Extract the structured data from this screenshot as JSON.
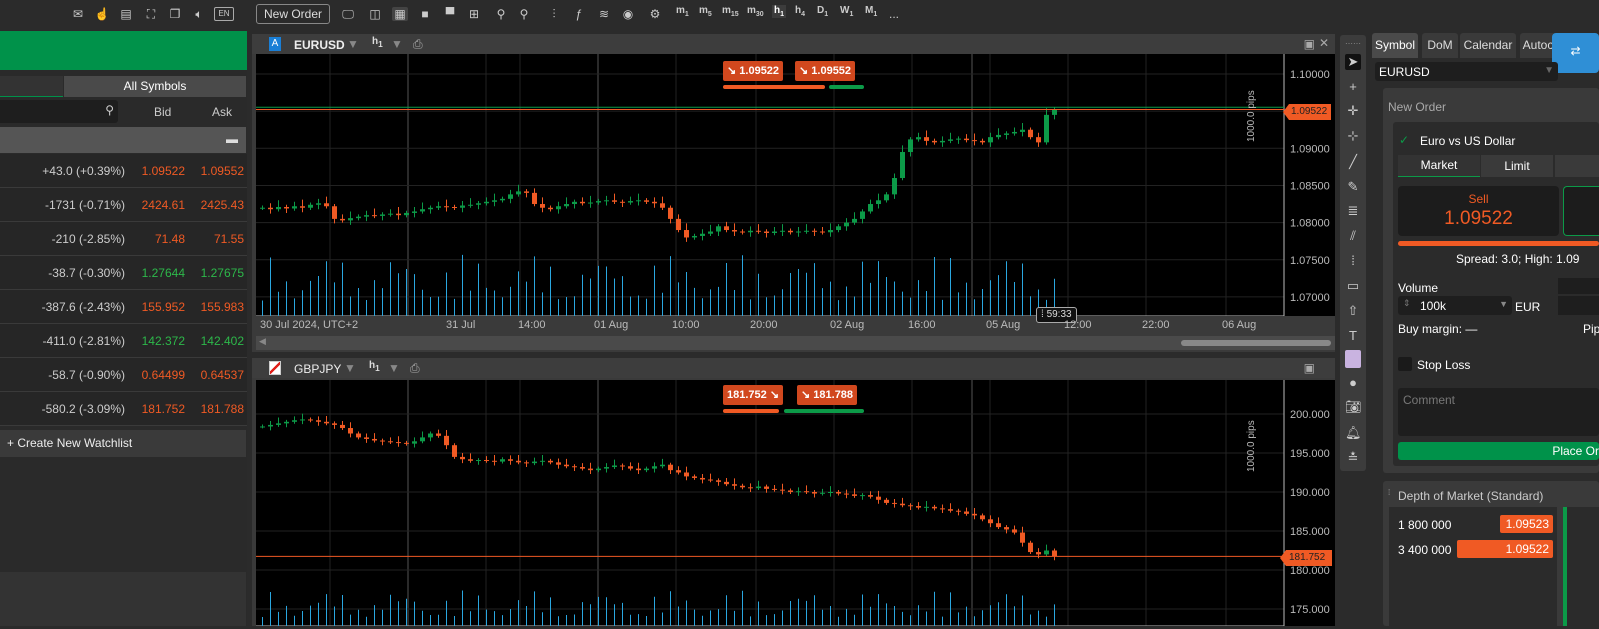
{
  "topbar": {
    "lang": "EN",
    "new_order": "New Order",
    "timeframes": [
      {
        "t": "m",
        "n": "1"
      },
      {
        "t": "m",
        "n": "5"
      },
      {
        "t": "m",
        "n": "15"
      },
      {
        "t": "m",
        "n": "30"
      },
      {
        "t": "h",
        "n": "1"
      },
      {
        "t": "h",
        "n": "4"
      },
      {
        "t": "D",
        "n": "1"
      },
      {
        "t": "W",
        "n": "1"
      },
      {
        "t": "M",
        "n": "1"
      }
    ],
    "more": "..."
  },
  "watchlist": {
    "tab_all": "All Symbols",
    "col_bid": "Bid",
    "col_ask": "Ask",
    "create": "+ Create New Watchlist",
    "rows": [
      {
        "change": "+43.0 (+0.39%)",
        "bid": "1.09522",
        "ask": "1.09552",
        "dir": "red"
      },
      {
        "change": "-1731 (-0.71%)",
        "bid": "2424.61",
        "ask": "2425.43",
        "dir": "red"
      },
      {
        "change": "-210 (-2.85%)",
        "bid": "71.48",
        "ask": "71.55",
        "dir": "red"
      },
      {
        "change": "-38.7 (-0.30%)",
        "bid": "1.27644",
        "ask": "1.27675",
        "dir": "grn"
      },
      {
        "change": "-387.6 (-2.43%)",
        "bid": "155.952",
        "ask": "155.983",
        "dir": "red"
      },
      {
        "change": "-411.0 (-2.81%)",
        "bid": "142.372",
        "ask": "142.402",
        "dir": "grn"
      },
      {
        "change": "-58.7 (-0.90%)",
        "bid": "0.64499",
        "ask": "0.64537",
        "dir": "red"
      },
      {
        "change": "-580.2 (-3.09%)",
        "bid": "181.752",
        "ask": "181.788",
        "dir": "red"
      }
    ]
  },
  "chart1": {
    "symbol": "EURUSD",
    "tf": "h",
    "tf_n": "1",
    "badge": "A",
    "sell": "1.09522",
    "buy": "1.09552",
    "price_tag": "1.09522",
    "pips": "1000.0 pips",
    "countdown": "59:33",
    "yticks": [
      "1.10000",
      "1.09500",
      "1.09000",
      "1.08500",
      "1.08000",
      "1.07500",
      "1.07000"
    ],
    "xticks": [
      "30 Jul 2024, UTC+2",
      "31 Jul",
      "14:00",
      "01 Aug",
      "10:00",
      "20:00",
      "02 Aug",
      "16:00",
      "05 Aug",
      "12:00",
      "22:00",
      "06 Aug"
    ]
  },
  "chart2": {
    "symbol": "GBPJPY",
    "tf": "h",
    "tf_n": "1",
    "sell": "181.752",
    "buy": "181.788",
    "price_tag": "181.752",
    "pips": "1000.0 pips",
    "yticks": [
      "200.000",
      "195.000",
      "190.000",
      "185.000",
      "180.000",
      "175.000"
    ]
  },
  "chart_data": [
    {
      "type": "candlestick",
      "symbol": "EURUSD",
      "ylim": [
        1.0675,
        1.1035
      ],
      "close": [
        1.082,
        1.0818,
        1.0821,
        1.0819,
        1.0822,
        1.082,
        1.0824,
        1.0826,
        1.0822,
        1.0805,
        1.0803,
        1.0806,
        1.0808,
        1.081,
        1.0809,
        1.0811,
        1.0812,
        1.081,
        1.0813,
        1.0815,
        1.0818,
        1.082,
        1.0822,
        1.0821,
        1.082,
        1.0823,
        1.0824,
        1.0826,
        1.0828,
        1.083,
        1.0832,
        1.0838,
        1.0842,
        1.084,
        1.0825,
        1.082,
        1.0818,
        1.0822,
        1.0825,
        1.0828,
        1.0826,
        1.0827,
        1.0829,
        1.083,
        1.0828,
        1.0827,
        1.0829,
        1.083,
        1.0828,
        1.0826,
        1.082,
        1.0805,
        1.079,
        1.078,
        1.0782,
        1.0785,
        1.0788,
        1.0795,
        1.079,
        1.0788,
        1.0787,
        1.0789,
        1.0788,
        1.0786,
        1.0788,
        1.0789,
        1.0787,
        1.0788,
        1.0789,
        1.0788,
        1.0787,
        1.079,
        1.0795,
        1.08,
        1.0805,
        1.0815,
        1.0825,
        1.083,
        1.0838,
        1.086,
        1.0895,
        1.0912,
        1.0915,
        1.091,
        1.0908,
        1.091,
        1.0912,
        1.0913,
        1.0911,
        1.091,
        1.0908,
        1.0915,
        1.0918,
        1.092,
        1.0922,
        1.0925,
        1.0915,
        1.0908,
        1.0945,
        1.0952
      ]
    },
    {
      "type": "candlestick",
      "symbol": "GBPJPY",
      "ylim": [
        174,
        205
      ],
      "close": [
        198.4,
        198.6,
        198.8,
        199.0,
        199.2,
        199.3,
        199.2,
        199.0,
        198.8,
        198.6,
        198.2,
        197.5,
        197.0,
        196.8,
        196.6,
        196.5,
        196.4,
        196.3,
        196.2,
        196.5,
        197.0,
        197.5,
        197.2,
        196.0,
        194.5,
        194.2,
        194.0,
        194.1,
        194.0,
        193.9,
        194.2,
        194.0,
        193.8,
        193.7,
        193.9,
        194.0,
        193.8,
        193.5,
        193.3,
        193.2,
        193.0,
        192.8,
        193.0,
        193.2,
        193.4,
        193.3,
        193.0,
        192.8,
        193.0,
        193.3,
        193.5,
        192.8,
        192.5,
        192.0,
        191.8,
        191.6,
        191.5,
        191.3,
        191.0,
        190.8,
        190.6,
        190.5,
        190.7,
        190.4,
        190.3,
        190.2,
        190.0,
        190.1,
        190.0,
        189.8,
        189.9,
        190.0,
        189.8,
        189.7,
        189.5,
        189.6,
        189.4,
        189.0,
        188.6,
        188.5,
        188.3,
        188.2,
        188.0,
        188.1,
        187.9,
        187.8,
        187.6,
        187.5,
        187.2,
        187.0,
        186.5,
        186.0,
        185.5,
        185.2,
        184.8,
        183.5,
        182.3,
        182.0,
        182.5,
        181.75
      ]
    }
  ],
  "right": {
    "tabs": [
      "Symbol",
      "DoM",
      "Calendar",
      "Autoc"
    ],
    "symbol": "EURUSD",
    "new_order": "New Order",
    "instrument": "Euro vs US Dollar",
    "order_tabs": [
      "Market",
      "Limit"
    ],
    "sell_label": "Sell",
    "sell_price": "1.09522",
    "spread": "Spread: 3.0; High: 1.09",
    "volume_label": "Volume",
    "volume": "100k",
    "currency": "EUR",
    "buy_margin": "Buy margin: —",
    "pip": "Pip",
    "stop_loss": "Stop Loss",
    "comment_placeholder": "Comment",
    "place": "Place Or",
    "dom_title": "Depth of Market (Standard)",
    "dom": [
      {
        "vol": "1 800 000",
        "price": "1.09523"
      },
      {
        "vol": "3 400 000",
        "price": "1.09522"
      }
    ]
  },
  "colors": {
    "green": "#00924a",
    "red": "#f05a24",
    "bull": "#0c9a48",
    "bear": "#f05a24",
    "volume": "#2aa7e0"
  }
}
